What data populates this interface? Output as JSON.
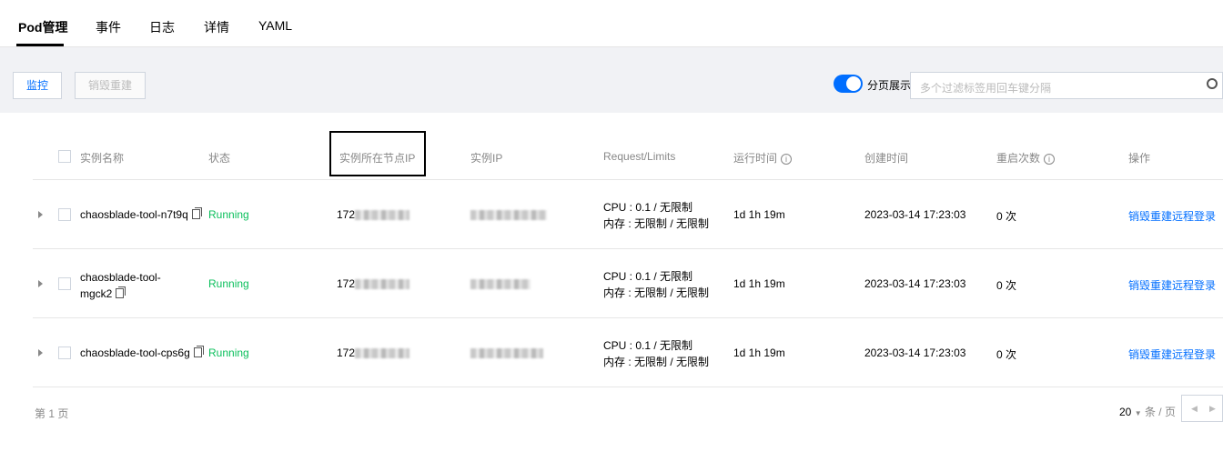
{
  "tabs": [
    {
      "label": "Pod管理",
      "active": true
    },
    {
      "label": "事件"
    },
    {
      "label": "日志"
    },
    {
      "label": "详情"
    },
    {
      "label": "YAML"
    }
  ],
  "toolbar": {
    "monitor_label": "监控",
    "destroy_rebuild_label": "销毁重建",
    "paging_toggle_label": "分页展示",
    "paging_toggle_on": true,
    "search_placeholder": "多个过滤标签用回车键分隔"
  },
  "table": {
    "headers": {
      "name": "实例名称",
      "status": "状态",
      "node_ip": "实例所在节点IP",
      "instance_ip": "实例IP",
      "request_limits": "Request/Limits",
      "uptime": "运行时间",
      "created": "创建时间",
      "restarts": "重启次数",
      "actions": "操作"
    },
    "rows": [
      {
        "name": "chaosblade-tool-n7t9q",
        "status": "Running",
        "node_ip": "172",
        "cpu": "CPU : 0.1 / 无限制",
        "memory": "内存 : 无限制 / 无限制",
        "uptime": "1d 1h 19m",
        "created": "2023-03-14 17:23:03",
        "restarts": "0 次",
        "action_destroy": "销毁重建",
        "action_remote": "远程登录"
      },
      {
        "name": "chaosblade-tool-mgck2",
        "status": "Running",
        "node_ip": "172",
        "cpu": "CPU : 0.1 / 无限制",
        "memory": "内存 : 无限制 / 无限制",
        "uptime": "1d 1h 19m",
        "created": "2023-03-14 17:23:03",
        "restarts": "0 次",
        "action_destroy": "销毁重建",
        "action_remote": "远程登录"
      },
      {
        "name": "chaosblade-tool-cps6g",
        "status": "Running",
        "node_ip": "172",
        "cpu": "CPU : 0.1 / 无限制",
        "memory": "内存 : 无限制 / 无限制",
        "uptime": "1d 1h 19m",
        "created": "2023-03-14 17:23:03",
        "restarts": "0 次",
        "action_destroy": "销毁重建",
        "action_remote": "远程登录"
      }
    ]
  },
  "footer": {
    "page_label": "第 1 页",
    "page_size": "20",
    "page_size_unit": "条 / 页"
  },
  "colors": {
    "accent": "#006eff",
    "running": "#0abf5b"
  }
}
